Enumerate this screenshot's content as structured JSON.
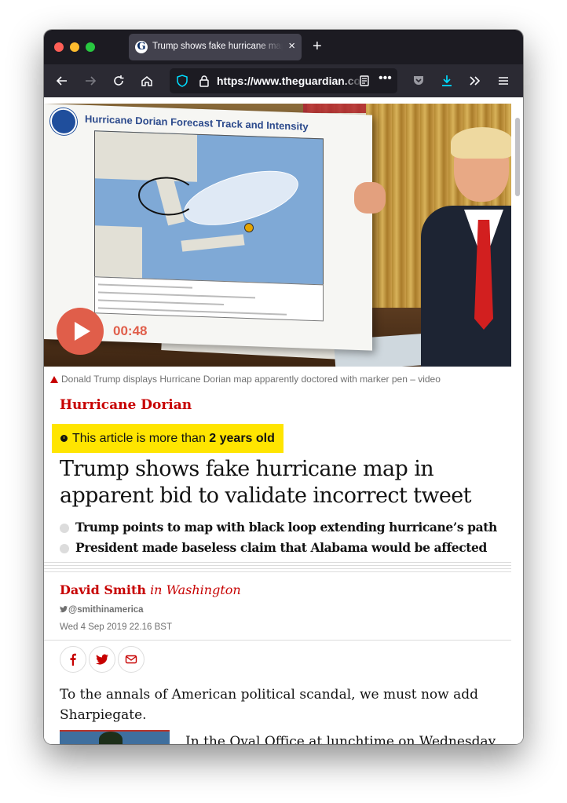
{
  "browser": {
    "tab": {
      "title": "Trump shows fake hurricane map",
      "favicon": "guardian-g-icon"
    },
    "url": "https://www.theguardian.com",
    "toolbar_icons": [
      "back-icon",
      "forward-icon",
      "reload-icon",
      "home-icon",
      "shield-icon",
      "lock-icon",
      "reader-view-icon",
      "more-icon",
      "pocket-icon",
      "downloads-icon",
      "overflow-icon",
      "menu-icon"
    ]
  },
  "media": {
    "map_title": "Hurricane Dorian Forecast Track and Intensity",
    "duration": "00:48"
  },
  "caption": "Donald Trump displays Hurricane Dorian map apparently doctored with marker pen – video",
  "article": {
    "kicker": "Hurricane Dorian",
    "age_notice": {
      "prefix": "This article is more than ",
      "emphasis": "2 years old"
    },
    "headline": "Trump shows fake hurricane map in apparent bid to validate incorrect tweet",
    "standfirst": [
      "Trump points to map with black loop extending hurricane’s path",
      "President made baseless claim that Alabama would be affected"
    ],
    "author": "David Smith",
    "location": "in Washington",
    "twitter": "@smithinamerica",
    "date": "Wed 4 Sep 2019 22.16 BST",
    "share": [
      "facebook-icon",
      "twitter-icon",
      "email-icon"
    ],
    "body_first": "To the annals of American political scandal, we must now add Sharpiegate.",
    "body_second": "In the Oval Office at lunchtime on Wednesday,"
  },
  "colors": {
    "brand_red": "#c70000",
    "age_badge": "#ffe500",
    "play_button": "#e05e4a",
    "browser_chrome": "#1c1b22",
    "accent_blue": "#00ddff"
  }
}
